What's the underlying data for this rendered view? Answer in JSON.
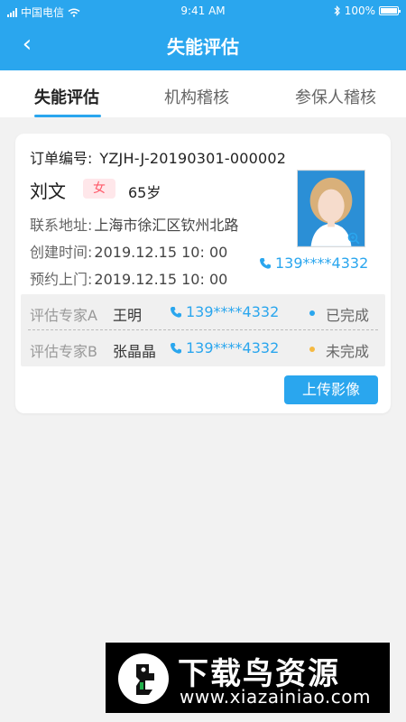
{
  "status_bar": {
    "carrier": "中国电信",
    "time": "9:41 AM",
    "battery": "100%"
  },
  "nav": {
    "title": "失能评估"
  },
  "tabs": [
    {
      "label": "失能评估",
      "active": true
    },
    {
      "label": "机构稽核",
      "active": false
    },
    {
      "label": "参保人稽核",
      "active": false
    }
  ],
  "card": {
    "order_label": "订单编号:",
    "order_value": "YZJH-J-20190301-000002",
    "name": "刘文",
    "gender": "女",
    "age": "65岁",
    "address_label": "联系地址:",
    "address_value": "上海市徐汇区钦州北路",
    "created_label": "创建时间:",
    "created_value": "2019.12.15 10: 00",
    "visit_label": "预约上门:",
    "visit_value": "2019.12.15 10: 00",
    "phone": "139****4332",
    "experts": [
      {
        "label": "评估专家A",
        "name": "王明",
        "phone": "139****4332",
        "status": "已完成",
        "dot_color": "#2aa6ee"
      },
      {
        "label": "评估专家B",
        "name": "张晶晶",
        "phone": "139****4332",
        "status": "未完成",
        "dot_color": "#f5b942"
      }
    ],
    "upload_button": "上传影像"
  },
  "watermark": {
    "title": "下载鸟资源",
    "url": "www.xiazainiao.com"
  },
  "colors": {
    "primary": "#2aa6ee",
    "gender_bg": "#ffe7ea",
    "gender_text": "#ff5a6a"
  }
}
